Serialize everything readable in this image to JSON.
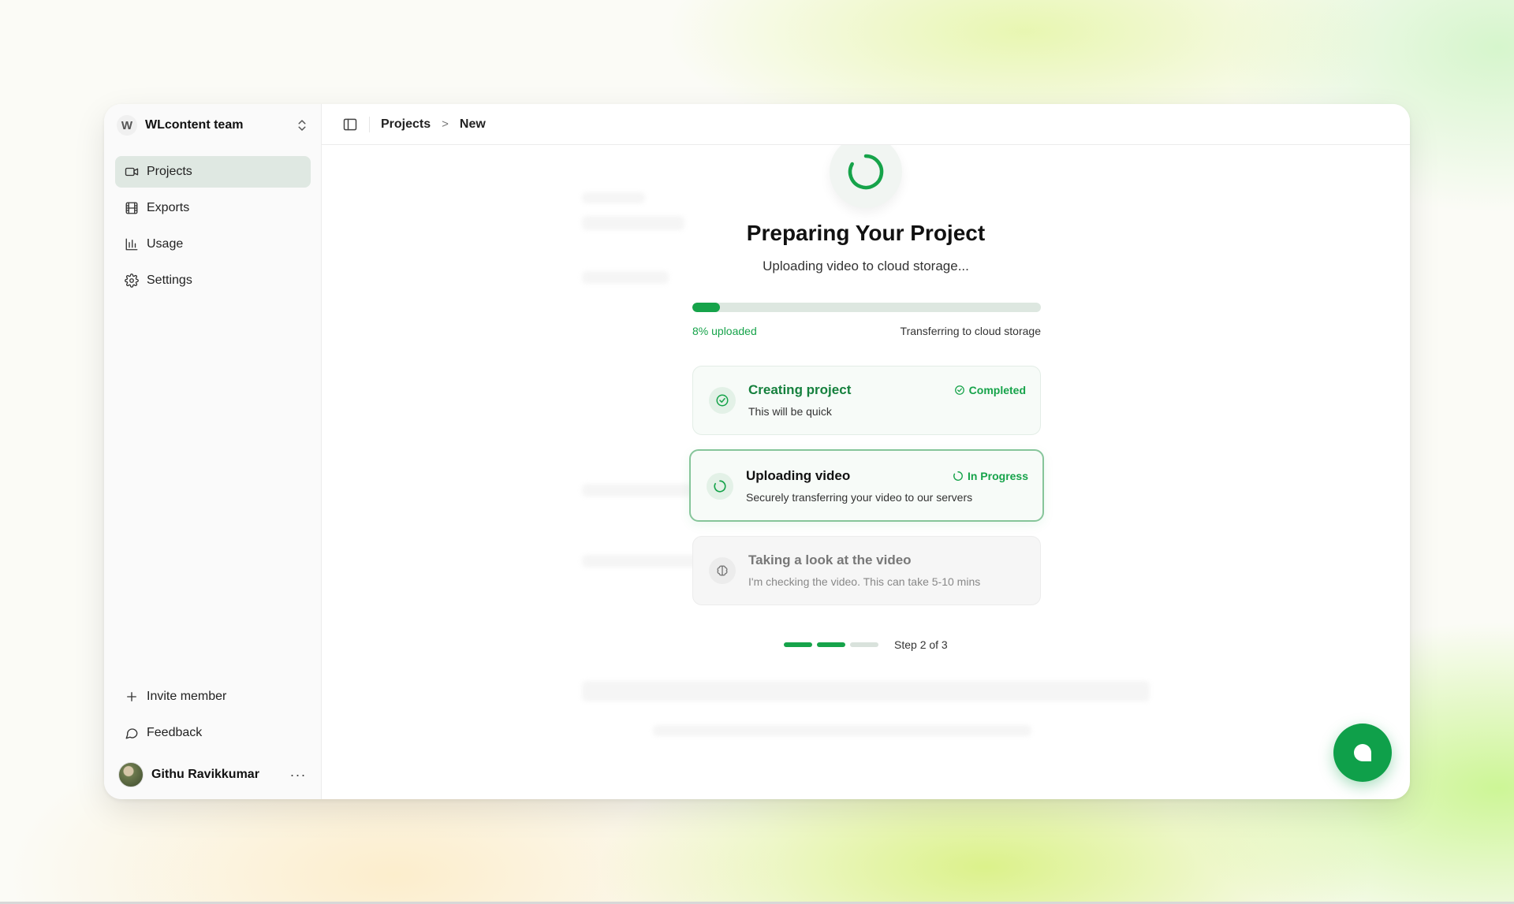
{
  "sidebar": {
    "team_initial": "W",
    "team_name": "WLcontent team",
    "items": [
      {
        "label": "Projects",
        "icon": "video-icon",
        "active": true
      },
      {
        "label": "Exports",
        "icon": "film-icon",
        "active": false
      },
      {
        "label": "Usage",
        "icon": "bar-chart-icon",
        "active": false
      },
      {
        "label": "Settings",
        "icon": "gear-icon",
        "active": false
      }
    ],
    "bottom_items": [
      {
        "label": "Invite member",
        "icon": "plus-icon"
      },
      {
        "label": "Feedback",
        "icon": "message-icon"
      }
    ],
    "user_name": "Githu Ravikkumar",
    "user_more": "···"
  },
  "breadcrumb": {
    "items": [
      "Projects",
      "New"
    ],
    "separator": ">"
  },
  "main": {
    "title": "Preparing Your Project",
    "subtitle": "Uploading video to cloud storage...",
    "progress": {
      "percent": 8,
      "left_label": "8% uploaded",
      "right_label": "Transferring to cloud storage"
    },
    "steps": [
      {
        "title": "Creating project",
        "desc": "This will be quick",
        "status": "Completed",
        "state": "done",
        "icon": "check-circle-icon"
      },
      {
        "title": "Uploading video",
        "desc": "Securely transferring your video to our servers",
        "status": "In Progress",
        "state": "active",
        "icon": "spinner-icon"
      },
      {
        "title": "Taking a look at the video",
        "desc": "I'm checking the video. This can take 5-10 mins",
        "status": "",
        "state": "pending",
        "icon": "brain-icon"
      }
    ],
    "stepper": {
      "current": 2,
      "total": 3,
      "label": "Step 2 of 3"
    }
  },
  "colors": {
    "accent": "#16a34a",
    "active_nav_bg": "#dfe8e2",
    "fab": "#0fa04a"
  }
}
